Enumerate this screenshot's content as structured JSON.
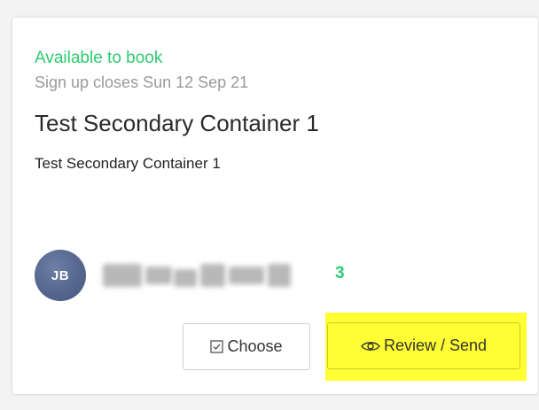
{
  "card": {
    "status": "Available to book",
    "signup": "Sign up closes Sun 12 Sep 21",
    "title": "Test Secondary Container 1",
    "description": "Test Secondary Container 1",
    "avatar_initials": "JB",
    "count": "3",
    "buttons": {
      "choose_label": "Choose",
      "review_label": "Review / Send"
    }
  },
  "colors": {
    "status_green": "#2ecc71",
    "avatar_blue": "#55678f",
    "highlight_yellow": "#ffff33"
  },
  "icons": {
    "choose": "checkbox-icon",
    "review": "eye-icon"
  }
}
